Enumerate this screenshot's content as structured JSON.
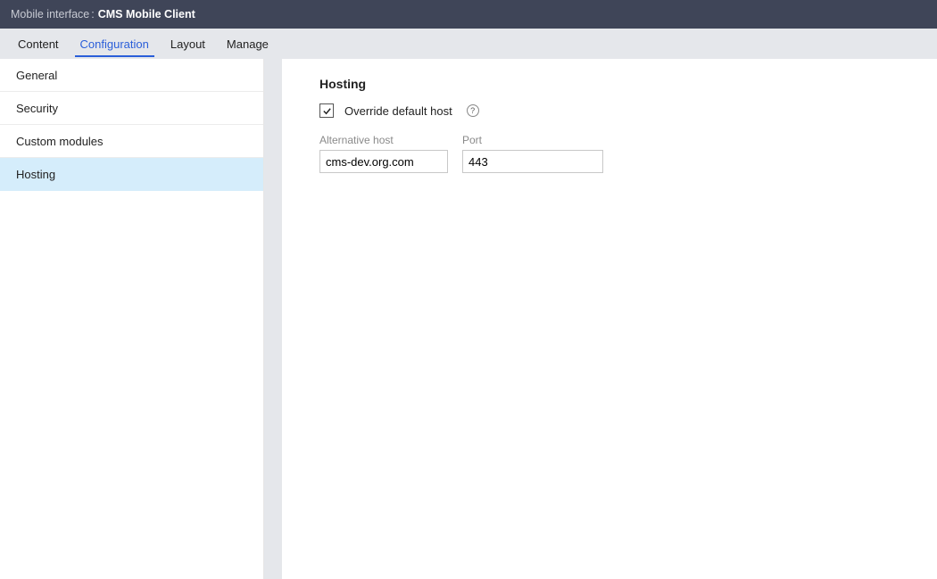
{
  "header": {
    "prefix": "Mobile interface",
    "separator": ":",
    "title": "CMS Mobile Client"
  },
  "tabs": [
    {
      "label": "Content",
      "active": false
    },
    {
      "label": "Configuration",
      "active": true
    },
    {
      "label": "Layout",
      "active": false
    },
    {
      "label": "Manage",
      "active": false
    }
  ],
  "sidebar": {
    "items": [
      {
        "label": "General",
        "selected": false
      },
      {
        "label": "Security",
        "selected": false
      },
      {
        "label": "Custom modules",
        "selected": false
      },
      {
        "label": "Hosting",
        "selected": true
      }
    ]
  },
  "main": {
    "title": "Hosting",
    "override": {
      "checked": true,
      "label": "Override default host"
    },
    "fields": {
      "alt_host_label": "Alternative host",
      "alt_host_value": "cms-dev.org.com",
      "port_label": "Port",
      "port_value": "443"
    }
  }
}
